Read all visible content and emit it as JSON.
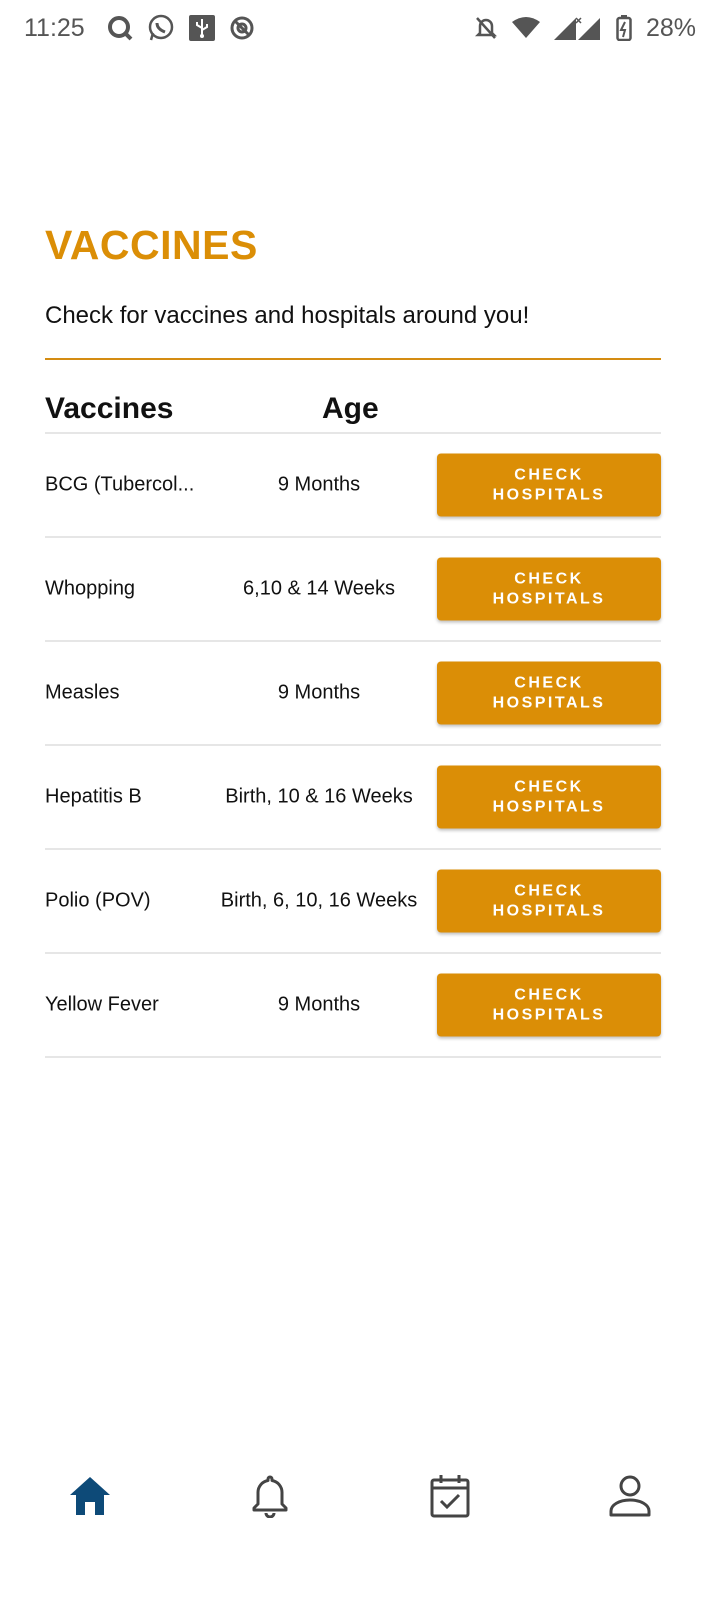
{
  "status_bar": {
    "time": "11:25",
    "left_icons": [
      "q-app-icon",
      "whatsapp-icon",
      "usb-icon",
      "vpn-icon"
    ],
    "right_icons": [
      "mute-icon",
      "wifi-icon",
      "signal-icon",
      "battery-icon"
    ],
    "battery": "28%"
  },
  "header": {
    "title": "VACCINES",
    "subtitle": "Check for vaccines and hospitals around you!"
  },
  "table": {
    "columns": [
      "Vaccines",
      "Age"
    ],
    "rows": [
      {
        "name": "BCG (Tubercol...",
        "age": "9 Months",
        "button": "CHECK HOSPITALS"
      },
      {
        "name": "Whopping",
        "age": "6,10 & 14 Weeks",
        "button": "CHECK HOSPITALS"
      },
      {
        "name": "Measles",
        "age": "9 Months",
        "button": "CHECK HOSPITALS"
      },
      {
        "name": "Hepatitis B",
        "age": "Birth, 10 & 16 Weeks",
        "button": "CHECK HOSPITALS"
      },
      {
        "name": "Polio (POV)",
        "age": "Birth, 6, 10, 16 Weeks",
        "button": "CHECK HOSPITALS"
      },
      {
        "name": "Yellow Fever",
        "age": "9 Months",
        "button": "CHECK HOSPITALS"
      }
    ]
  },
  "bottom_nav": {
    "items": [
      "home-icon",
      "bell-icon",
      "calendar-check-icon",
      "profile-icon"
    ],
    "active": "home-icon"
  },
  "colors": {
    "accent": "#db8e06",
    "nav_active": "#0d4a78",
    "nav_inactive": "#444444"
  }
}
